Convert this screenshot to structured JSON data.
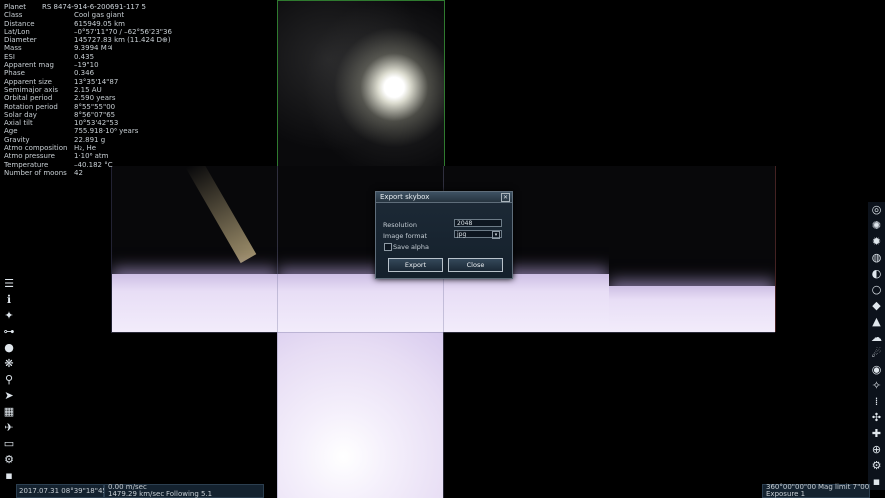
{
  "info_panel": {
    "header_label": "Planet",
    "header_value": "RS 8474-914-6-200691-117 5",
    "rows": [
      {
        "key": "Class",
        "value": "Cool gas giant"
      },
      {
        "key": "Distance",
        "value": "615949.05 km"
      },
      {
        "key": "Lat/Lon",
        "value": "–0°57'11\"70 / –62°56'23\"36"
      },
      {
        "key": "Diameter",
        "value": "145727.83 km (11.424 D⊕)"
      },
      {
        "key": "Mass",
        "value": "9.3994 M♃"
      },
      {
        "key": "ESI",
        "value": "0.435"
      },
      {
        "key": "Apparent mag",
        "value": "–19\"10"
      },
      {
        "key": "Phase",
        "value": "0.346"
      },
      {
        "key": "Apparent size",
        "value": "13°35'14\"87"
      },
      {
        "key": "Semimajor axis",
        "value": "2.15 AU"
      },
      {
        "key": "Orbital period",
        "value": "2.590 years"
      },
      {
        "key": "Rotation period",
        "value": "8°55\"55\"00"
      },
      {
        "key": "Solar day",
        "value": "8°56\"07\"65"
      },
      {
        "key": "Axial tilt",
        "value": "10°53'42\"53"
      },
      {
        "key": "Age",
        "value": "755.918·10⁶ years"
      },
      {
        "key": "Gravity",
        "value": "22.891 g"
      },
      {
        "key": "Atmo composition",
        "value": "H₂, He"
      },
      {
        "key": "Atmo pressure",
        "value": "1·10⁶ atm"
      },
      {
        "key": "Temperature",
        "value": "–40.182 °C"
      },
      {
        "key": "Number of moons",
        "value": "42"
      }
    ]
  },
  "dialog": {
    "title": "Export skybox",
    "resolution_label": "Resolution",
    "resolution_value": "2048",
    "format_label": "Image format",
    "format_value": "jpg",
    "save_alpha_label": "Save alpha",
    "save_alpha_checked": false,
    "export_label": "Export",
    "close_label": "Close"
  },
  "status_bar": {
    "datetime": "2017.07.31  08°39\"18\"45",
    "speed_1": "0.00  m/sec",
    "speed_2": "1479.29  km/sec",
    "following": "Following  5.1",
    "view_angle": "360°00\"00\"00",
    "mag_limit": "Mag limit  7\"00",
    "exposure": "Exposure  1"
  },
  "left_toolbar_icons": [
    "menu-icon",
    "info-icon",
    "star-browser-icon",
    "orbit-icon",
    "planets-icon",
    "galaxy-icon",
    "search-icon",
    "ship-icon",
    "calendar-icon",
    "flight-icon",
    "display-icon",
    "settings-icon",
    "small-gear-icon"
  ],
  "right_toolbar_icons": [
    "galaxy-map-icon",
    "nebula-icon",
    "star-icon",
    "planet-ring-icon",
    "orbit-planet-icon",
    "ring-icon",
    "asteroid-icon",
    "surface-icon",
    "cloud-icon",
    "comet-icon",
    "eye-icon",
    "constellation-icon",
    "grid-dots-icon",
    "network-icon",
    "compass-icon",
    "globe-icon",
    "settings-icon",
    "small-gear-icon"
  ],
  "colors": {
    "accent": "#5f6d7a",
    "dialog_bg": "#1a2631",
    "planet_glow": "#e8def6"
  }
}
